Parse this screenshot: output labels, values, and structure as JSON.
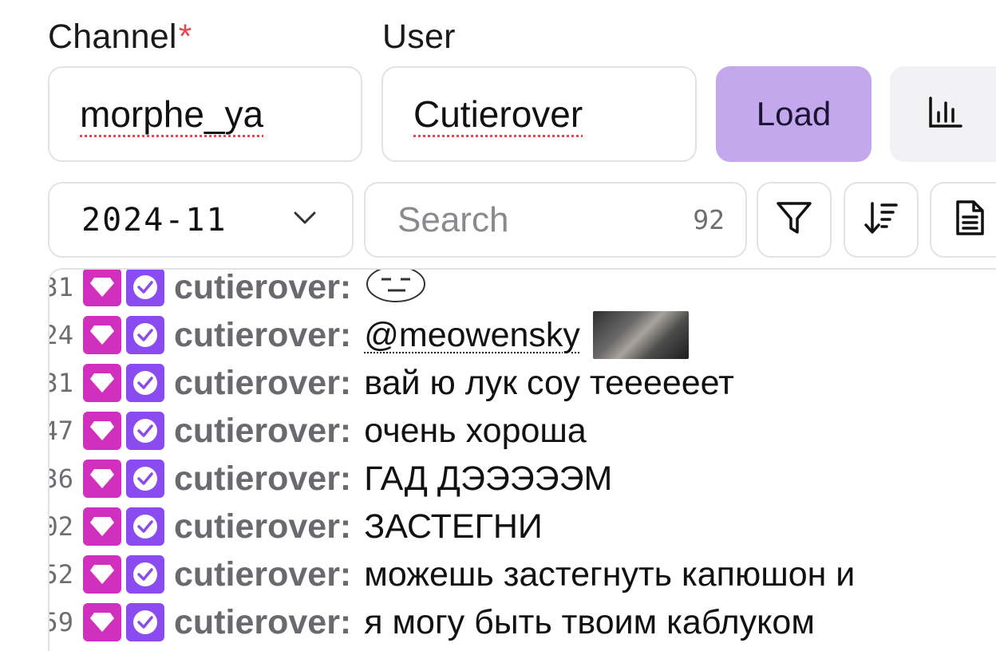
{
  "form": {
    "channel_label": "Channel",
    "required_mark": "*",
    "channel_value": "morphe_ya",
    "user_label": "User",
    "user_value": "Cutierover",
    "load_label": "Load",
    "stats_icon": "bar-chart-icon"
  },
  "toolbar": {
    "month_value": "2024-11",
    "search_placeholder": "Search",
    "result_count": "92",
    "filter_icon": "filter-icon",
    "sort_icon": "sort-icon",
    "doc_icon": "document-icon"
  },
  "colors": {
    "accent": "#c4a8ee",
    "sub_badge": "#d12fbe",
    "vip_badge": "#8a4cf0",
    "required": "#e5484d"
  },
  "messages": [
    {
      "time": "31",
      "user": "cutierover:",
      "text": "",
      "emote": "sus-face-emote"
    },
    {
      "time": "24",
      "user": "cutierover:",
      "text": "@meowensky",
      "mention": true,
      "thumb": "photo-emote"
    },
    {
      "time": "31",
      "user": "cutierover:",
      "text": "вай ю лук соу теееееет"
    },
    {
      "time": "47",
      "user": "cutierover:",
      "text": "очень хороша"
    },
    {
      "time": "36",
      "user": "cutierover:",
      "text": "ГАД ДЭЭЭЭЭМ"
    },
    {
      "time": "02",
      "user": "cutierover:",
      "text": "ЗАСТЕГНИ"
    },
    {
      "time": "52",
      "user": "cutierover:",
      "text": "можешь застегнуть капюшон и"
    },
    {
      "time": "59",
      "user": "cutierover:",
      "text": "я могу быть твоим каблуком"
    }
  ]
}
